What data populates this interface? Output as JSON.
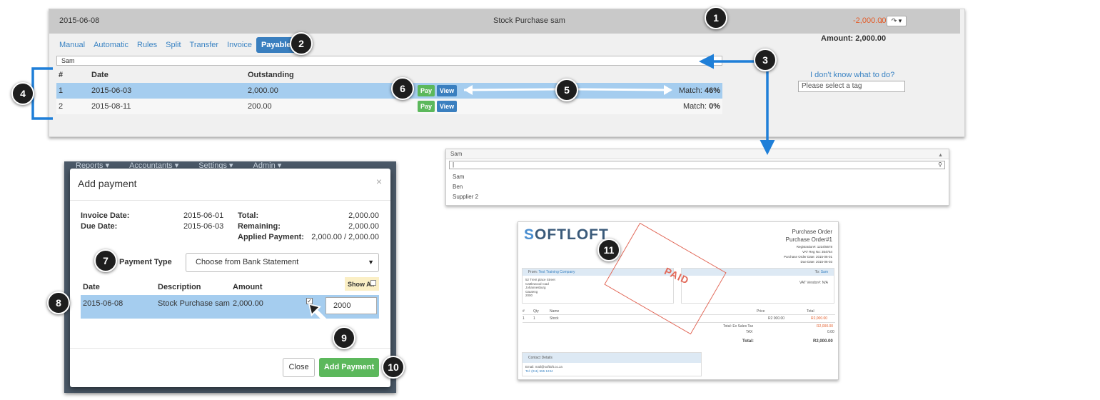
{
  "transaction": {
    "date": "2015-06-08",
    "description": "Stock Purchase sam",
    "amount": "-2,000.00",
    "amount_arrow": "↓",
    "dropdown_label": "↷ ▾",
    "amount_label": "Amount:",
    "amount_value": "2,000.00"
  },
  "tabs": [
    "Manual",
    "Automatic",
    "Rules",
    "Split",
    "Transfer",
    "Invoice",
    "Payable"
  ],
  "search_value": "Sam",
  "match_table": {
    "headers": {
      "idx": "#",
      "date": "Date",
      "outstanding": "Outstanding"
    },
    "rows": [
      {
        "idx": "1",
        "date": "2015-06-03",
        "outstanding": "2,000.00",
        "match_label": "Match:",
        "match_pct": "46%",
        "pay": "Pay",
        "view": "View"
      },
      {
        "idx": "2",
        "date": "2015-08-11",
        "outstanding": "200.00",
        "match_label": "Match:",
        "match_pct": "0%",
        "pay": "Pay",
        "view": "View"
      }
    ]
  },
  "help": {
    "dont_know": "I don't know what to do?",
    "tag_placeholder": "Please select a tag"
  },
  "dropdown": {
    "selected": "Sam",
    "caret": "▲",
    "search_value": "|",
    "options": [
      "Sam",
      "Ben",
      "Supplier 2"
    ]
  },
  "modal_nav": [
    "Reports ▾",
    "Accountants ▾",
    "Settings ▾",
    "Admin ▾"
  ],
  "modal": {
    "title": "Add payment",
    "close_x": "×",
    "invoice_date_label": "Invoice Date:",
    "invoice_date": "2015-06-01",
    "due_date_label": "Due Date:",
    "due_date": "2015-06-03",
    "total_label": "Total:",
    "total": "2,000.00",
    "remaining_label": "Remaining:",
    "remaining": "2,000.00",
    "applied_label": "Applied Payment:",
    "applied": "2,000.00 / 2,000.00",
    "payment_type_label": "Payment Type",
    "payment_type_value": "Choose from Bank Statement",
    "payment_type_caret": "▼",
    "headers": {
      "date": "Date",
      "description": "Description",
      "amount": "Amount",
      "show_all": "Show All"
    },
    "row": {
      "date": "2015-06-08",
      "description": "Stock Purchase sam",
      "amount": "2,000.00",
      "input": "2000",
      "check": "✓"
    },
    "close_button": "Close",
    "add_button": "Add Payment"
  },
  "purchase_order": {
    "logo_prefix": "S",
    "logo_text": "OFTLOFT",
    "title": "Purchase Order",
    "number": "Purchase Order#1",
    "reg": "Registration#: 1234/5678",
    "vat": "VAT Reg No: 354754",
    "order_date": "Purchase Order Date: 2015-06-01",
    "due_date": "Due Date: 2015-06-03",
    "from_label": "From:",
    "from_name": "Test Training Company",
    "address": [
      "52 Trent place Street",
      "Cattlewood road",
      "Johannesburg",
      "Gauteng",
      "2000"
    ],
    "to_label": "To:",
    "to_name": "Sam",
    "vat_vendor": "VAT Vendor#: N/A",
    "table_headers": [
      "#",
      "Qty",
      "Name",
      "Price",
      "Total"
    ],
    "table_row": [
      "1",
      "1",
      "Stock",
      "R2 000.00",
      "R2,000.00"
    ],
    "total_ex_label": "Total: Ex Sales Tax",
    "total_ex": "R2,000.00",
    "tax_label": "TAX",
    "tax": "0.00",
    "total_label": "Total:",
    "total": "R2,000.00",
    "contact_label": "Contact Details",
    "email": "Email: mail@softloft.co.za",
    "tel": "Tel: (011) 555 1234",
    "stamp": "PAID"
  },
  "badges": [
    "1",
    "2",
    "3",
    "4",
    "5",
    "6",
    "7",
    "8",
    "9",
    "10",
    "11"
  ],
  "colors": {
    "accent_blue": "#3a7fbf",
    "pay_green": "#5cb85c",
    "negative": "#e35d2a",
    "selection": "#a5cdef",
    "annotation_blue": "#1f7fd8"
  }
}
